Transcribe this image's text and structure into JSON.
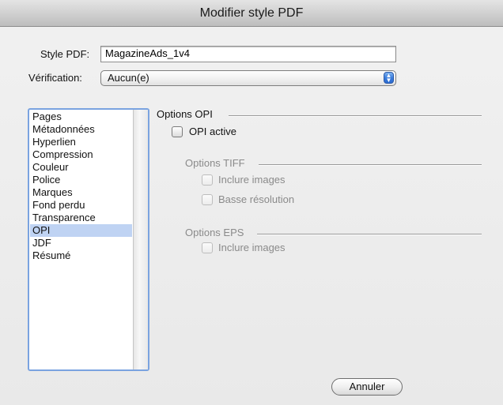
{
  "window": {
    "title": "Modifier style PDF"
  },
  "style_pdf": {
    "label": "Style PDF:",
    "value": "MagazineAds_1v4"
  },
  "verification": {
    "label": "Vérification:",
    "selected": "Aucun(e)",
    "options_icon": "updown-arrows-icon"
  },
  "sidebar": {
    "items": [
      {
        "label": "Pages"
      },
      {
        "label": "Métadonnées"
      },
      {
        "label": "Hyperlien"
      },
      {
        "label": "Compression"
      },
      {
        "label": "Couleur"
      },
      {
        "label": "Police"
      },
      {
        "label": "Marques"
      },
      {
        "label": "Fond perdu"
      },
      {
        "label": "Transparence"
      },
      {
        "label": "OPI"
      },
      {
        "label": "JDF"
      },
      {
        "label": "Résumé"
      }
    ],
    "selected": "OPI",
    "selection_color": "#bfd3f3"
  },
  "opi": {
    "section_title": "Options OPI",
    "active_label": "OPI active",
    "active_checked": false,
    "tiff": {
      "section_title": "Options TIFF",
      "include_images_label": "Inclure images",
      "low_res_label": "Basse résolution"
    },
    "eps": {
      "section_title": "Options EPS",
      "include_images_label": "Inclure images"
    }
  },
  "buttons": {
    "cancel_label": "Annuler"
  }
}
